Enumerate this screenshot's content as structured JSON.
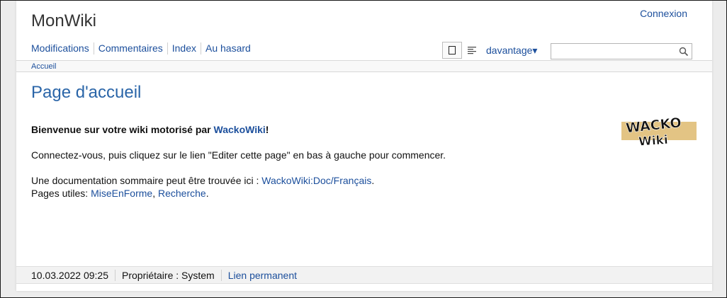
{
  "header": {
    "site_title": "MonWiki",
    "login_label": "Connexion"
  },
  "nav": {
    "items": [
      {
        "label": "Modifications"
      },
      {
        "label": "Commentaires"
      },
      {
        "label": "Index"
      },
      {
        "label": "Au hasard"
      }
    ]
  },
  "tools": {
    "more_label": "davantage▾"
  },
  "search": {
    "value": "",
    "placeholder": ""
  },
  "breadcrumb": {
    "label": "Accueil"
  },
  "main": {
    "title": "Page d'accueil",
    "welcome_prefix": "Bienvenue sur votre wiki motorisé par ",
    "welcome_link": "WackoWiki",
    "welcome_suffix": "!",
    "instructions": "Connectez-vous, puis cliquez sur le lien \"Editer cette page\" en bas à gauche pour commencer.",
    "doc_prefix": "Une documentation sommaire peut être trouvée ici : ",
    "doc_link": "WackoWiki:Doc/Français",
    "doc_suffix": ".",
    "useful_prefix": "Pages utiles: ",
    "useful_link1": "MiseEnForme",
    "useful_sep": ", ",
    "useful_link2": "Recherche",
    "useful_suffix": ".",
    "logo_text_line1": "WACKO",
    "logo_text_line2": "Wiki"
  },
  "footer": {
    "datetime": "10.03.2022 09:25",
    "owner": "Propriétaire : System",
    "permalink": "Lien permanent"
  },
  "colors": {
    "link": "#1c4f9c",
    "title": "#2a65a8",
    "logo_band": "#e3c484"
  }
}
